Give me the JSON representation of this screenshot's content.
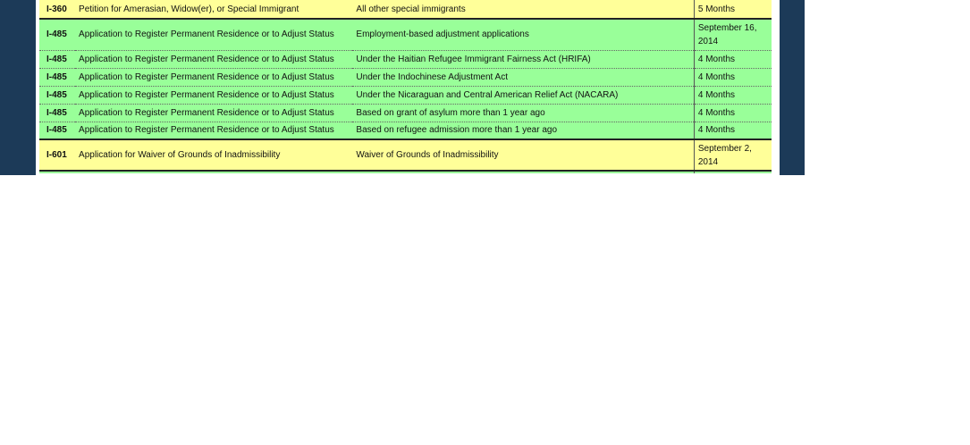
{
  "rows": [
    {
      "form": "I-360",
      "title": "Petition for Amerasian, Widow(er), or Special Immigrant",
      "category": "All other special immigrants",
      "time": "5 Months",
      "color": "yellow"
    },
    {
      "form": "I-485",
      "title": "Application to Register Permanent Residence or to Adjust Status",
      "category": "Employment-based adjustment applications",
      "time": "September 16, 2014",
      "color": "green"
    },
    {
      "form": "I-485",
      "title": "Application to Register Permanent Residence or to Adjust Status",
      "category": "Under the Haitian Refugee Immigrant Fairness Act (HRIFA)",
      "time": "4 Months",
      "color": "green"
    },
    {
      "form": "I-485",
      "title": "Application to Register Permanent Residence or to Adjust Status",
      "category": "Under the Indochinese Adjustment Act",
      "time": "4 Months",
      "color": "green"
    },
    {
      "form": "I-485",
      "title": "Application to Register Permanent Residence or to Adjust Status",
      "category": "Under the Nicaraguan and Central American Relief Act (NACARA)",
      "time": "4 Months",
      "color": "green"
    },
    {
      "form": "I-485",
      "title": "Application to Register Permanent Residence or to Adjust Status",
      "category": "Based on grant of asylum more than 1 year ago",
      "time": "4 Months",
      "color": "green"
    },
    {
      "form": "I-485",
      "title": "Application to Register Permanent Residence or to Adjust Status",
      "category": "Based on refugee admission more than 1 year ago",
      "time": "4 Months",
      "color": "green"
    },
    {
      "form": "I-601",
      "title": "Application for Waiver of Grounds of Inadmissibility",
      "category": "Waiver of Grounds of Inadmissibility",
      "time": "September 2, 2014",
      "color": "yellow"
    }
  ],
  "colors": {
    "frame": "#1c3a58",
    "yellow_row": "#ffff99",
    "green_row": "#99ff99"
  }
}
